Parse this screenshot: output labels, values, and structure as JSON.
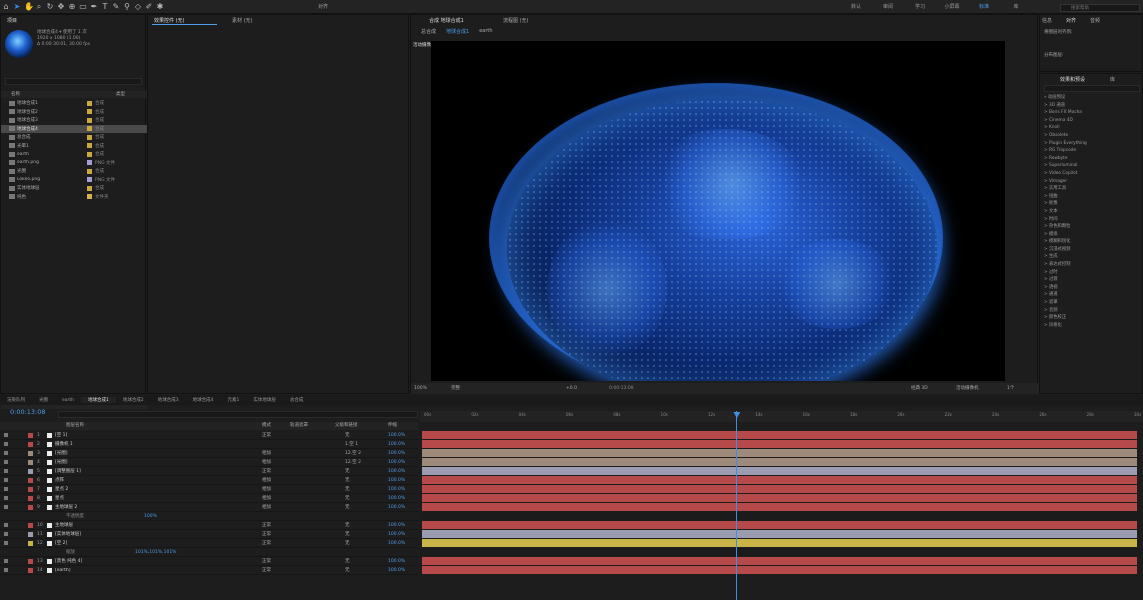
{
  "toolbar": {
    "workspaces": [
      "默认",
      "审阅",
      "学习",
      "小屏幕",
      "标准",
      "库"
    ],
    "active_workspace": "标准",
    "search_placeholder": "搜索帮助",
    "snap_label": "对齐"
  },
  "project": {
    "title": "项目",
    "comp_name": "地球合成4",
    "used": "使用了 1 次",
    "size": "1920 x 1080 (1.00)",
    "duration": "Δ 0:00:30:01, 30.00 fps",
    "col_name": "名称",
    "col_type": "类型",
    "items": [
      {
        "name": "地球合成1",
        "type": "合成",
        "color": "#c9a83e"
      },
      {
        "name": "地球合成2",
        "type": "合成",
        "color": "#c9a83e"
      },
      {
        "name": "地球合成3",
        "type": "合成",
        "color": "#c9a83e"
      },
      {
        "name": "地球合成4",
        "type": "合成",
        "color": "#c9a83e"
      },
      {
        "name": "总合成",
        "type": "合成",
        "color": "#c9a83e"
      },
      {
        "name": "光晕1",
        "type": "合成",
        "color": "#c9a83e"
      },
      {
        "name": "earth",
        "type": "合成",
        "color": "#c9a83e"
      },
      {
        "name": "earth.png",
        "type": "PNG 文件",
        "color": "#a99bd8"
      },
      {
        "name": "光圈",
        "type": "合成",
        "color": "#c9a83e"
      },
      {
        "name": "Lokeo.png",
        "type": "PNG 文件",
        "color": "#a99bd8"
      },
      {
        "name": "实体地球层",
        "type": "合成",
        "color": "#c9a83e"
      },
      {
        "name": "纯色",
        "type": "文件夹",
        "color": "#d6b04a"
      }
    ],
    "bpc": "16 bpc"
  },
  "effects_panel": {
    "tab": "效果控件 (无)",
    "tab2": "素材 (无)"
  },
  "comp": {
    "tab": "合成 地球合成1",
    "tab2": "流程图 (无)",
    "breadcrumbs": [
      "总合成",
      "地球合成1",
      "earth"
    ],
    "camera_label": "活动摄像机 (摄像机 1)",
    "zoom": "100%",
    "quality": "完整",
    "exposure": "+0.0",
    "timecode": "0:00:13:08",
    "renderer": "经典 3D",
    "view_camera": "活动摄像机",
    "views": "1个"
  },
  "info_panel": {
    "tabs": [
      "信息",
      "对齐",
      "音频"
    ],
    "align_to": "将图层对齐到:",
    "distribute": "分布图层:"
  },
  "fx_presets": {
    "title": "效果和预设",
    "lib": "库",
    "items": [
      "» 动画预设",
      "> 3D 通道",
      "> Boris FX Mocha",
      "> Cinema 4D",
      "> Knoll",
      "> Obsolete",
      "> Plugin Everything",
      "> RG Trapcode",
      "> Rowbyte",
      "> Superluminal",
      "> Video Copilot",
      "> Vimager",
      "> 实用工具",
      "> 扭曲",
      "> 抠像",
      "> 文本",
      "> 时间",
      "> 杂色和颗粒",
      "> 模拟",
      "> 模糊和锐化",
      "> 沉浸式视频",
      "> 生成",
      "> 表达式控制",
      "> 过时",
      "> 过渡",
      "> 透视",
      "> 通道",
      "> 遮罩",
      "> 音频",
      "> 颜色校正",
      "> 风格化"
    ]
  },
  "timeline": {
    "tabs": [
      "渲染队列",
      "光圈",
      "earth",
      "地球合成1",
      "地球合成2",
      "地球合成3",
      "地球合成4",
      "元素1",
      "实体地球层",
      "总合成"
    ],
    "active_tab": "地球合成1",
    "timecode": "0:00:13:08",
    "col_layer": "图层名称",
    "col_mode": "模式",
    "col_trk": "轨道遮罩",
    "col_parent": "父级和链接",
    "col_stretch": "伸缩",
    "ruler": [
      "00s",
      "02s",
      "04s",
      "06s",
      "08s",
      "10s",
      "12s",
      "14s",
      "16s",
      "18s",
      "20s",
      "22s",
      "24s",
      "26s",
      "28s",
      "30s"
    ],
    "playhead_fraction": 0.44,
    "layers": [
      {
        "num": "1",
        "name": "[空 1]",
        "mode": "正常",
        "parent": "无",
        "color": "#b64a4a",
        "stretch": "100.0%"
      },
      {
        "num": "2",
        "name": "摄像机 1",
        "mode": "",
        "parent": "1.空 1",
        "color": "#b64a4a",
        "stretch": "100.0%"
      },
      {
        "num": "3",
        "name": "[光圈]",
        "mode": "相加",
        "parent": "12.空 2",
        "color": "#9e8a7a",
        "stretch": "100.0%"
      },
      {
        "num": "4",
        "name": "[光圈]",
        "mode": "相加",
        "parent": "12.空 2",
        "color": "#9e8a7a",
        "stretch": "100.0%"
      },
      {
        "num": "5",
        "name": "[调整图层 1]",
        "mode": "正常",
        "parent": "无",
        "color": "#9c9cb0",
        "stretch": "100.0%"
      },
      {
        "num": "6",
        "name": "点阵",
        "mode": "相加",
        "parent": "无",
        "color": "#b64a4a",
        "stretch": "100.0%"
      },
      {
        "num": "7",
        "name": "星点 2",
        "mode": "相加",
        "parent": "无",
        "color": "#b64a4a",
        "stretch": "100.0%"
      },
      {
        "num": "8",
        "name": "星点",
        "mode": "相加",
        "parent": "无",
        "color": "#b64a4a",
        "stretch": "100.0%"
      },
      {
        "num": "9",
        "name": "主地球层 2",
        "mode": "相加",
        "parent": "无",
        "color": "#b64a4a",
        "stretch": "100.0%"
      },
      {
        "num": "",
        "name": "不透明度",
        "sub": true,
        "value": "100%"
      },
      {
        "num": "10",
        "name": "主地球层",
        "mode": "正常",
        "parent": "无",
        "color": "#b64a4a",
        "stretch": "100.0%"
      },
      {
        "num": "11",
        "name": "[实体地球层]",
        "mode": "正常",
        "parent": "无",
        "color": "#9c9cb0",
        "stretch": "100.0%"
      },
      {
        "num": "12",
        "name": "[空 2]",
        "mode": "正常",
        "parent": "无",
        "color": "#c9b44a",
        "stretch": "100.0%"
      },
      {
        "num": "",
        "name": "缩放",
        "sub": true,
        "value": "101%,101%,101%"
      },
      {
        "num": "13",
        "name": "[黑色 纯色 4]",
        "mode": "正常",
        "parent": "无",
        "color": "#b64a4a",
        "stretch": "100.0%"
      },
      {
        "num": "14",
        "name": "[earth]",
        "mode": "正常",
        "parent": "无",
        "color": "#b64a4a",
        "stretch": "100.0%"
      }
    ]
  }
}
